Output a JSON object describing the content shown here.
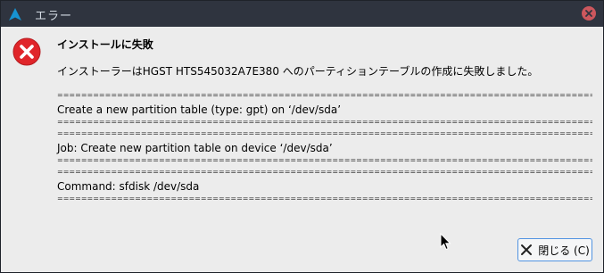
{
  "window": {
    "title": "エラー"
  },
  "dialog": {
    "heading": "インストールに失敗",
    "message": "インストーラーはHGST HTS545032A7E380 へのパーティションテーブルの作成に失敗しました。",
    "separator": "================================================================================================================================================",
    "details": [
      "Create a new partition table (type: gpt) on ‘/dev/sda’",
      "Job: Create new partition table on device ‘/dev/sda’",
      "Command: sfdisk /dev/sda"
    ],
    "close_button_label": "閉じる (C)"
  },
  "colors": {
    "titlebar": "#2f343f",
    "titlebar_text": "#d3dae3",
    "close_red": "#cc575d",
    "error_red": "#e0252a",
    "focus_blue": "#5294e2",
    "window_bg": "#ececec"
  },
  "icons": {
    "app": "arch-logo-icon",
    "window_close": "close-icon",
    "error": "error-icon",
    "button": "x-icon",
    "cursor": "mouse-cursor-icon"
  }
}
